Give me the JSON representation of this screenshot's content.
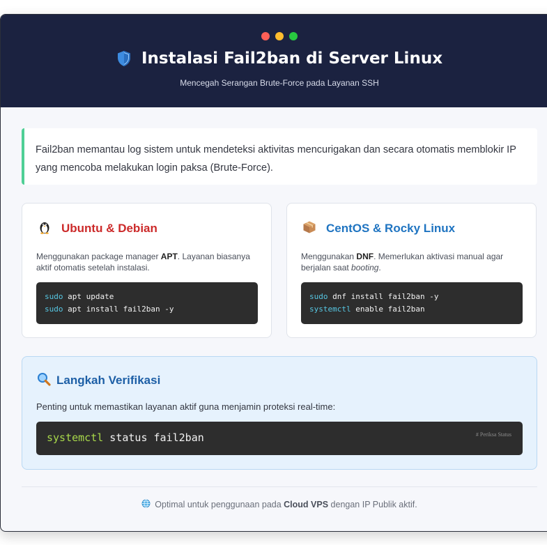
{
  "header": {
    "title": "Instalasi Fail2ban di Server Linux",
    "subtitle": "Mencegah Serangan Brute-Force pada Layanan SSH",
    "dot_colors": [
      "#ff5f57",
      "#febc2e",
      "#28c840"
    ]
  },
  "intro": {
    "text": "Fail2ban memantau log sistem untuk mendeteksi aktivitas mencurigakan dan secara otomatis memblokir IP yang mencoba melakukan login paksa (Brute-Force)."
  },
  "ubuntu": {
    "icon": "penguin-icon",
    "title": "Ubuntu & Debian",
    "title_color": "#cc2a2a",
    "desc_prefix": "Menggunakan package manager ",
    "desc_bold": "APT",
    "desc_suffix": ". Layanan biasanya aktif otomatis setelah instalasi.",
    "code": [
      {
        "cmd": "sudo",
        "args": " apt update"
      },
      {
        "cmd": "sudo",
        "args": " apt install fail2ban -y"
      }
    ]
  },
  "centos": {
    "icon": "package-icon",
    "title": "CentOS & Rocky Linux",
    "title_color": "#1f74c1",
    "desc_prefix": "Menggunakan ",
    "desc_bold": "DNF",
    "desc_middle": ". Memerlukan aktivasi manual agar berjalan saat ",
    "desc_italic": "booting",
    "desc_suffix": ".",
    "code": [
      {
        "cmd": "sudo",
        "args": " dnf install fail2ban -y"
      },
      {
        "cmd": "systemctl",
        "args": " enable fail2ban"
      }
    ]
  },
  "verify": {
    "icon": "magnifier-icon",
    "title": "Langkah Verifikasi",
    "desc": "Penting untuk memastikan layanan aktif guna menjamin proteksi real-time:",
    "cmd": "systemctl",
    "args": " status fail2ban",
    "comment": "# Periksa Status"
  },
  "footer": {
    "icon": "globe-icon",
    "prefix": "Optimal untuk penggunaan pada ",
    "bold": "Cloud VPS",
    "suffix": " dengan IP Publik aktif."
  }
}
